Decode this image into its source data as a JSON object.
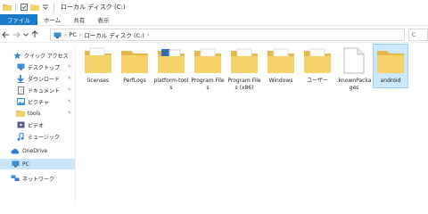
{
  "window": {
    "title": "ローカル ディスク (C:)"
  },
  "ribbon": {
    "tabs": [
      "ファイル",
      "ホーム",
      "共有",
      "表示"
    ]
  },
  "address": {
    "crumbs": [
      "PC",
      "ローカル ディスク (C:)"
    ],
    "search_hint": "C"
  },
  "sidebar": {
    "items": [
      {
        "label": "クイック アクセス",
        "icon": "star-icon"
      },
      {
        "label": "デスクトップ",
        "icon": "desktop-icon",
        "pinned": true
      },
      {
        "label": "ダウンロード",
        "icon": "download-icon",
        "pinned": true
      },
      {
        "label": "ドキュメント",
        "icon": "document-icon",
        "pinned": true
      },
      {
        "label": "ピクチャ",
        "icon": "picture-icon",
        "pinned": true
      },
      {
        "label": "tools",
        "icon": "folder-icon",
        "pinned": true
      },
      {
        "label": "ビデオ",
        "icon": "video-icon"
      },
      {
        "label": "ミュージック",
        "icon": "music-icon"
      },
      {
        "label": "OneDrive",
        "icon": "cloud-icon"
      },
      {
        "label": "PC",
        "icon": "pc-icon",
        "selected": true
      },
      {
        "label": "ネットワーク",
        "icon": "network-icon"
      }
    ]
  },
  "files": [
    {
      "label": "licenses",
      "type": "folder"
    },
    {
      "label": "PerfLogs",
      "type": "folder"
    },
    {
      "label": "platform-tools",
      "type": "folder-blue"
    },
    {
      "label": "Program Files",
      "type": "folder"
    },
    {
      "label": "Program Files (x86)",
      "type": "folder"
    },
    {
      "label": "Windows",
      "type": "folder"
    },
    {
      "label": "ユーザー",
      "type": "folder"
    },
    {
      "label": ".knownPackages",
      "type": "file"
    },
    {
      "label": "android",
      "type": "folder",
      "selected": true
    }
  ],
  "colors": {
    "folder": "#f6d26b",
    "folder_dark": "#e6b84a",
    "accent": "#1979ca",
    "selection": "#cce8ff"
  }
}
